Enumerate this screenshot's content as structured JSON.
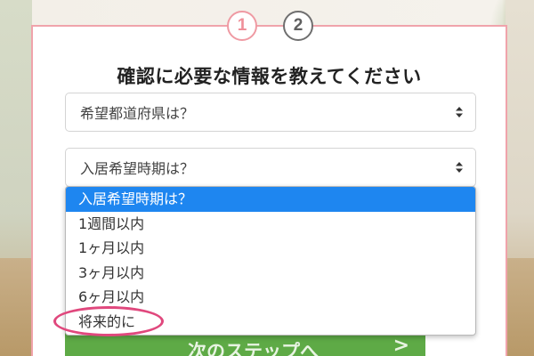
{
  "steps": [
    {
      "label": "1",
      "active": true
    },
    {
      "label": "2",
      "active": false
    }
  ],
  "form": {
    "title": "確認に必要な情報を教えてください",
    "prefecture_select": {
      "value": "希望都道府県は？"
    },
    "move_in_select": {
      "value": "入居希望時期は？"
    }
  },
  "dropdown": {
    "options": [
      "入居希望時期は？",
      "1週間以内",
      "1ヶ月以内",
      "3ヶ月以内",
      "6ヶ月以内",
      "将来的に"
    ],
    "selected_index": 0,
    "highlighted_option": "将来的に"
  },
  "next_button": {
    "label": "次のステップへ",
    "arrow": ">"
  },
  "colors": {
    "card_border": "#f0a3ab",
    "step_active": "#ef8f99",
    "step_inactive": "#5f5f5f",
    "selected_option_bg": "#1e86f0",
    "next_button_bg": "#5eaa46",
    "highlight_ring": "#e0487d"
  },
  "icons": {
    "select_arrows": "sort-updown-icon"
  }
}
